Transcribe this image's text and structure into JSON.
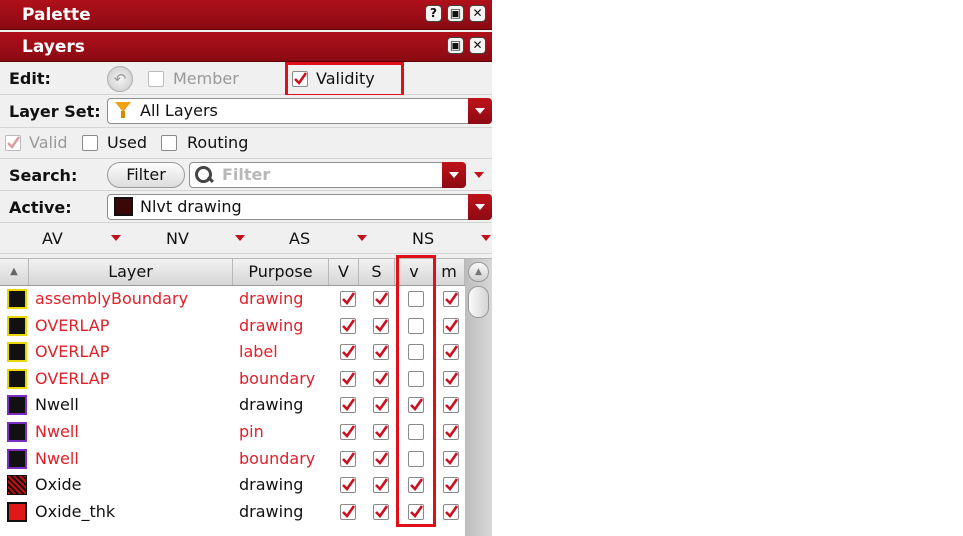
{
  "palette": {
    "title": "Palette"
  },
  "layers_panel": {
    "title": "Layers"
  },
  "edit": {
    "label": "Edit:",
    "member_label": "Member",
    "validity_label": "Validity"
  },
  "layer_set": {
    "label": "Layer Set:",
    "value": "All Layers"
  },
  "filters": {
    "valid_label": "Valid",
    "used_label": "Used",
    "routing_label": "Routing"
  },
  "search": {
    "label": "Search:",
    "filter_button": "Filter",
    "placeholder": "Filter"
  },
  "active": {
    "label": "Active:",
    "value": "Nlvt drawing"
  },
  "visibility_toggles": [
    "AV",
    "NV",
    "AS",
    "NS"
  ],
  "table": {
    "headers": [
      "Layer",
      "Purpose",
      "V",
      "S",
      "v",
      "m"
    ],
    "rows": [
      {
        "layer": "assemblyBoundary",
        "purpose": "drawing",
        "V": true,
        "S": true,
        "v": false,
        "m": true,
        "red": true,
        "swatch": "yellow"
      },
      {
        "layer": "OVERLAP",
        "purpose": "drawing",
        "V": true,
        "S": true,
        "v": false,
        "m": true,
        "red": true,
        "swatch": "yellow"
      },
      {
        "layer": "OVERLAP",
        "purpose": "label",
        "V": true,
        "S": true,
        "v": false,
        "m": true,
        "red": true,
        "swatch": "yellow"
      },
      {
        "layer": "OVERLAP",
        "purpose": "boundary",
        "V": true,
        "S": true,
        "v": false,
        "m": true,
        "red": true,
        "swatch": "yellow"
      },
      {
        "layer": "Nwell",
        "purpose": "drawing",
        "V": true,
        "S": true,
        "v": true,
        "m": true,
        "red": false,
        "swatch": "purple"
      },
      {
        "layer": "Nwell",
        "purpose": "pin",
        "V": true,
        "S": true,
        "v": false,
        "m": true,
        "red": true,
        "swatch": "purple"
      },
      {
        "layer": "Nwell",
        "purpose": "boundary",
        "V": true,
        "S": true,
        "v": false,
        "m": true,
        "red": true,
        "swatch": "purple"
      },
      {
        "layer": "Oxide",
        "purpose": "drawing",
        "V": true,
        "S": true,
        "v": true,
        "m": true,
        "red": false,
        "swatch": "oxide"
      },
      {
        "layer": "Oxide_thk",
        "purpose": "drawing",
        "V": true,
        "S": true,
        "v": true,
        "m": true,
        "red": false,
        "swatch": "oxidethk"
      }
    ]
  },
  "colors": {
    "title_bar": "#9c0c14",
    "highlight": "#e0101a",
    "invalid_text": "#e0202a",
    "check": "#cc1020"
  },
  "icons": {
    "help": "help-icon",
    "float": "float-icon",
    "close": "close-icon",
    "undo": "undo-icon",
    "funnel": "funnel-icon",
    "search": "search-icon"
  }
}
